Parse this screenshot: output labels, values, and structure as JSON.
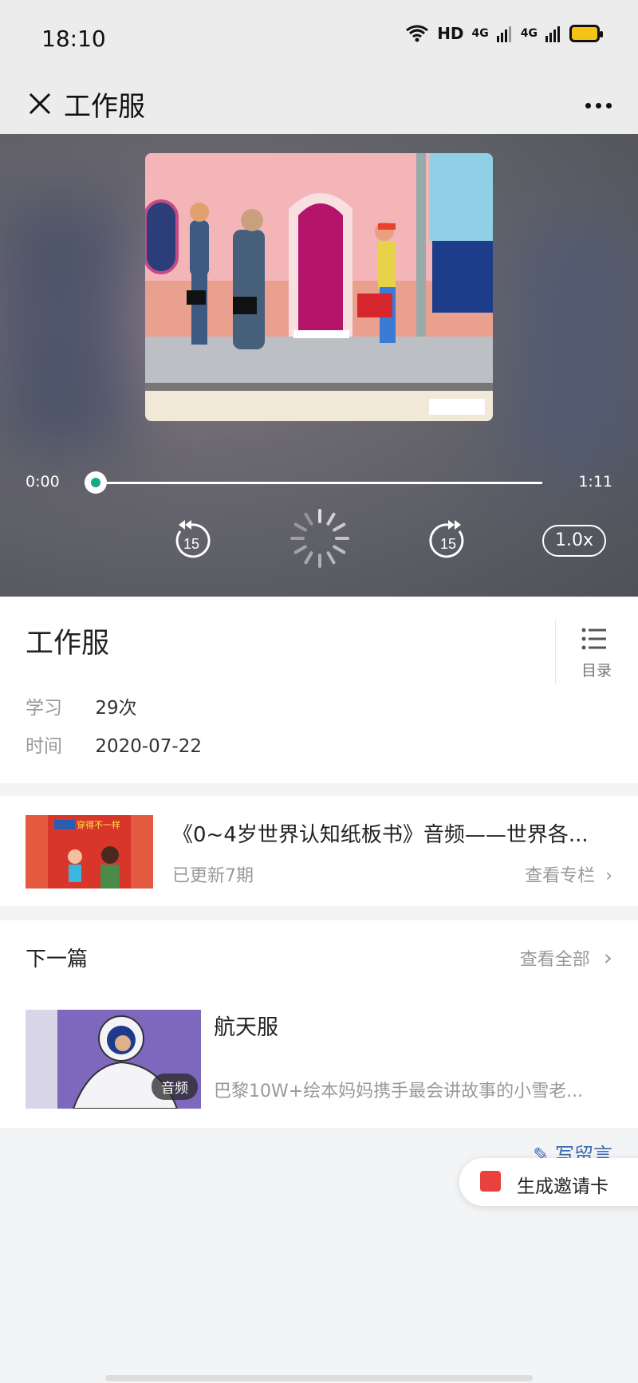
{
  "status": {
    "time": "18:10",
    "network": "HD",
    "signal1": "4G",
    "signal2": "4G"
  },
  "nav": {
    "title": "工作服"
  },
  "player": {
    "current_time": "0:00",
    "total_time": "1:11",
    "progress": 0.0,
    "rewind_label": "15",
    "forward_label": "15",
    "speed": "1.0x"
  },
  "info": {
    "title": "工作服",
    "toc_label": "目录",
    "study_key": "学习",
    "study_value": "29次",
    "date_key": "时间",
    "date_value": "2020-07-22"
  },
  "album": {
    "title": "《0~4岁世界认知纸板书》音频——世界各...",
    "updated": "已更新7期",
    "view_label": "查看专栏",
    "cover_text": "穿得不一样"
  },
  "next": {
    "header": "下一篇",
    "view_all": "查看全部",
    "item_title": "航天服",
    "item_desc": "巴黎10W+绘本妈妈携手最会讲故事的小雪老...",
    "badge": "音频"
  },
  "comment": {
    "write_label": "写留言"
  },
  "invite": {
    "label": "生成邀请卡"
  },
  "colors": {
    "accent": "#1aa987",
    "invite_red": "#e8413e"
  }
}
